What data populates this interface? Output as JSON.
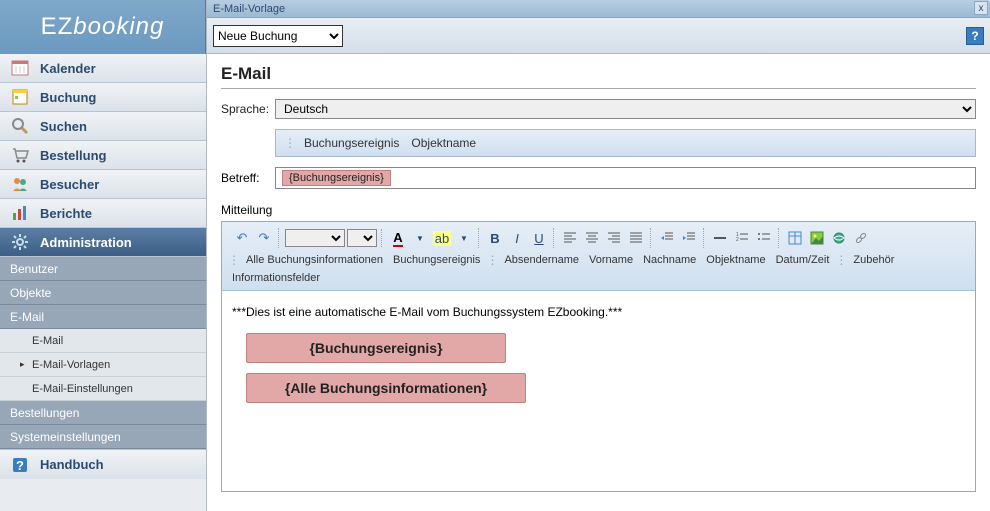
{
  "app": {
    "name_a": "EZ",
    "name_b": "booking"
  },
  "nav": {
    "kalender": "Kalender",
    "buchung": "Buchung",
    "suchen": "Suchen",
    "bestellung": "Bestellung",
    "besucher": "Besucher",
    "berichte": "Berichte",
    "administration": "Administration",
    "handbuch": "Handbuch"
  },
  "admin_sub": {
    "benutzer": "Benutzer",
    "objekte": "Objekte",
    "email": "E-Mail",
    "email_item": "E-Mail",
    "email_vorlagen": "E-Mail-Vorlagen",
    "email_einstellungen": "E-Mail-Einstellungen",
    "bestellungen": "Bestellungen",
    "system": "Systemeinstellungen"
  },
  "window": {
    "title": "E-Mail-Vorlage",
    "close": "x"
  },
  "template_select": {
    "value": "Neue Buchung"
  },
  "section": {
    "title": "E-Mail"
  },
  "language": {
    "label": "Sprache:",
    "value": "Deutsch"
  },
  "subject_placeholders": {
    "a": "Buchungsereignis",
    "b": "Objektname"
  },
  "subject": {
    "label": "Betreff:",
    "pill": "{Buchungsereignis}"
  },
  "mitteilung": {
    "label": "Mitteilung"
  },
  "editor_tags": {
    "a": "Alle Buchungsinformationen",
    "b": "Buchungsereignis",
    "c": "Absendername",
    "d": "Vorname",
    "e": "Nachname",
    "f": "Objektname",
    "g": "Datum/Zeit",
    "h": "Zubehör",
    "i": "Informationsfelder"
  },
  "editor_body": {
    "autoline": "***Dies ist eine automatische E-Mail vom Buchungssystem EZbooking.***",
    "pill1": "{Buchungsereignis}",
    "pill2": "{Alle Buchungsinformationen}"
  }
}
